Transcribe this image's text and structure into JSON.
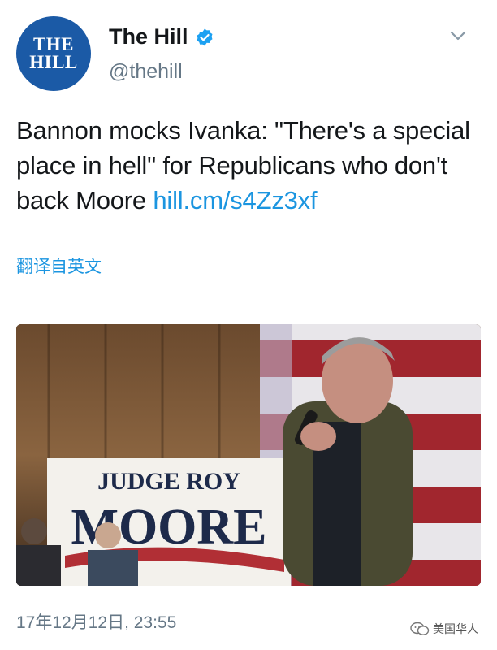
{
  "account": {
    "avatar_line1": "THE",
    "avatar_line2": "HILL",
    "display_name": "The Hill",
    "handle": "@thehill"
  },
  "tweet": {
    "text": "Bannon mocks Ivanka: \"There's a special place in hell\" for Republicans who don't back Moore ",
    "link": "hill.cm/s4Zz3xf",
    "translate_label": "翻译自英文",
    "timestamp": "17年12月12日, 23:55"
  },
  "media": {
    "sign_line1": "JUDGE ROY",
    "sign_line2": "MOORE"
  },
  "watermark": {
    "label": "美国华人"
  },
  "colors": {
    "link": "#1b95e0",
    "avatar_bg": "#1b5aa6",
    "secondary_text": "#657786"
  },
  "icons": [
    "verified-badge-icon",
    "chevron-down-icon",
    "wechat-watermark-icon"
  ]
}
